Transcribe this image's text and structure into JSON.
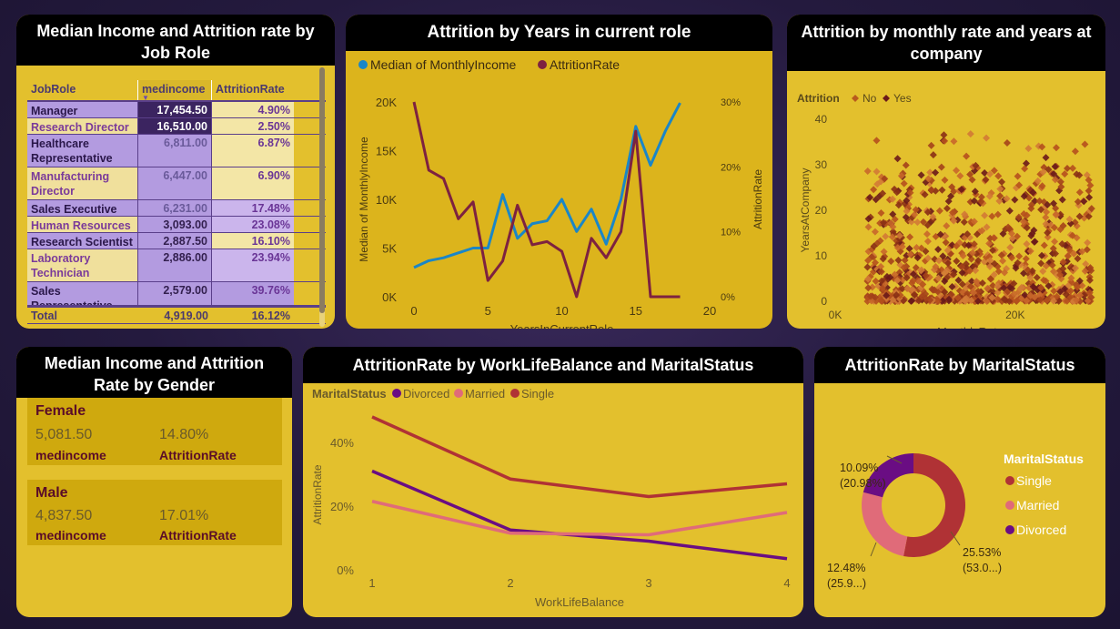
{
  "colors": {
    "page_bg": "#24193f",
    "card": "#e3c02d",
    "title_bg": "#000000",
    "blue": "#1a86c7",
    "maroon": "#7d2240",
    "divorced": "#6a0d83",
    "married": "#e06b79",
    "single": "#b03235",
    "purple_light": "#b39be0",
    "purple_dark": "#3b2460"
  },
  "table_card": {
    "title": "Median Income and Attrition rate by Job Role",
    "headers": [
      "JobRole",
      "medincome",
      "AttritionRate"
    ],
    "rows": [
      {
        "role": "Manager",
        "income": "17,454.50",
        "rate": "4.90%"
      },
      {
        "role": "Research Director",
        "income": "16,510.00",
        "rate": "2.50%"
      },
      {
        "role": "Healthcare Representative",
        "income": "6,811.00",
        "rate": "6.87%"
      },
      {
        "role": "Manufacturing Director",
        "income": "6,447.00",
        "rate": "6.90%"
      },
      {
        "role": "Sales Executive",
        "income": "6,231.00",
        "rate": "17.48%"
      },
      {
        "role": "Human Resources",
        "income": "3,093.00",
        "rate": "23.08%"
      },
      {
        "role": "Research Scientist",
        "income": "2,887.50",
        "rate": "16.10%"
      },
      {
        "role": "Laboratory Technician",
        "income": "2,886.00",
        "rate": "23.94%"
      },
      {
        "role": "Sales Representative",
        "income": "2,579.00",
        "rate": "39.76%"
      }
    ],
    "total": {
      "role": "Total",
      "income": "4,919.00",
      "rate": "16.12%"
    }
  },
  "gender_card": {
    "title": "Median Income and Attrition Rate by Gender",
    "groups": [
      {
        "name": "Female",
        "income": "5,081.50",
        "rate": "14.80%",
        "income_label": "medincome",
        "rate_label": "AttritionRate"
      },
      {
        "name": "Male",
        "income": "4,837.50",
        "rate": "17.01%",
        "income_label": "medincome",
        "rate_label": "AttritionRate"
      }
    ]
  },
  "chart_data": [
    {
      "type": "line",
      "title": "Attrition by Years in current role",
      "xlabel": "YearsInCurrentRole",
      "ylabel": "Median of MonthlyIncome",
      "y2label": "AttritionRate",
      "xlim": [
        0,
        20
      ],
      "ylim": [
        0,
        20000
      ],
      "y2lim": [
        0,
        30
      ],
      "xticks": [
        "0",
        "5",
        "10",
        "15",
        "20"
      ],
      "yticks": [
        "0K",
        "5K",
        "10K",
        "15K",
        "20K"
      ],
      "y2ticks": [
        "0%",
        "10%",
        "20%",
        "30%"
      ],
      "legend": [
        "Median of MonthlyIncome",
        "AttritionRate"
      ],
      "x": [
        0,
        1,
        2,
        3,
        4,
        5,
        6,
        7,
        8,
        9,
        10,
        11,
        12,
        13,
        14,
        15,
        16,
        17,
        18
      ],
      "series": [
        {
          "name": "Median of MonthlyIncome",
          "axis": "left",
          "values": [
            3000,
            3700,
            4000,
            4500,
            5000,
            5000,
            10500,
            6000,
            7500,
            7800,
            10000,
            6700,
            9000,
            5400,
            10000,
            17500,
            13500,
            17000,
            19900
          ]
        },
        {
          "name": "AttritionRate",
          "axis": "right",
          "values": [
            30,
            19.5,
            18.2,
            12,
            14.6,
            2.5,
            5.5,
            14.1,
            8,
            8.5,
            7,
            0,
            9,
            6,
            10,
            25.5,
            0,
            0,
            0
          ]
        }
      ]
    },
    {
      "type": "scatter",
      "title": "Attrition by monthly rate and years at company",
      "xlabel": "MonthlyRate",
      "ylabel": "YearsAtCompany",
      "legend_title": "Attrition",
      "legend": [
        "No",
        "Yes"
      ],
      "xlim": [
        0,
        27000
      ],
      "ylim": [
        0,
        40
      ],
      "xticks": [
        "0K",
        "20K"
      ],
      "yticks": [
        "0",
        "10",
        "20",
        "30",
        "40"
      ]
    },
    {
      "type": "line",
      "title": "AttritionRate by WorkLifeBalance and MaritalStatus",
      "xlabel": "WorkLifeBalance",
      "ylabel": "AttritionRate",
      "legend_title": "MaritalStatus",
      "legend": [
        "Divorced",
        "Married",
        "Single"
      ],
      "categories": [
        "1",
        "2",
        "3",
        "4"
      ],
      "ylim": [
        0,
        50
      ],
      "yticks": [
        "0%",
        "20%",
        "40%"
      ],
      "series": [
        {
          "name": "Divorced",
          "values": [
            31,
            12.5,
            9,
            3.5
          ]
        },
        {
          "name": "Married",
          "values": [
            21.5,
            11.5,
            11,
            18
          ]
        },
        {
          "name": "Single",
          "values": [
            48,
            28.5,
            23,
            27
          ]
        }
      ]
    },
    {
      "type": "pie",
      "title": "AttritionRate by MaritalStatus",
      "legend_title": "MaritalStatus",
      "legend": [
        "Single",
        "Married",
        "Divorced"
      ],
      "slices": [
        {
          "name": "Single",
          "value": 25.53,
          "share": "(53.0...)",
          "label": "25.53%"
        },
        {
          "name": "Married",
          "value": 12.48,
          "share": "(25.9...)",
          "label": "12.48%"
        },
        {
          "name": "Divorced",
          "value": 10.09,
          "share": "(20.98%)",
          "label": "10.09%"
        }
      ]
    }
  ]
}
